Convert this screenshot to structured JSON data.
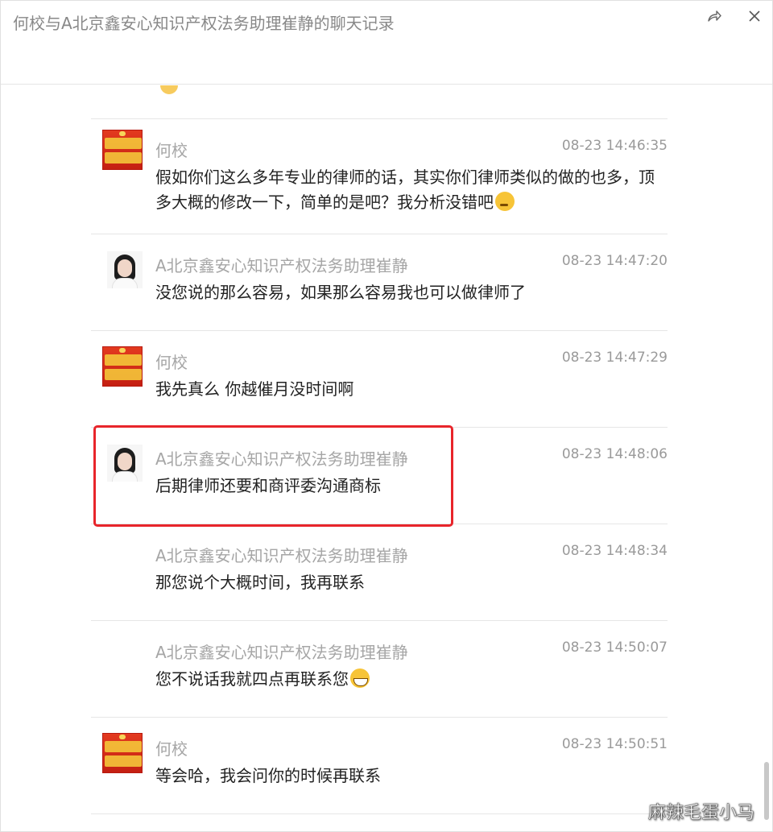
{
  "window": {
    "title": "何校与A北京鑫安心知识产权法务助理崔静的聊天记录",
    "share_icon": "share-arrow-icon",
    "close_icon": "close-icon"
  },
  "messages": [
    {
      "sender": "何校",
      "time": "08-23 14:46:35",
      "text": "假如你们这么多年专业的律师的话，其实你们律师类似的做的也多，顶多大概的修改一下，简单的是吧？我分析没错吧",
      "avatar": "red-banner-avatar",
      "emoji": "thinking-face"
    },
    {
      "sender": "A北京鑫安心知识产权法务助理崔静",
      "time": "08-23 14:47:20",
      "text": "没您说的那么容易，如果那么容易我也可以做律师了",
      "avatar": "woman-photo-avatar"
    },
    {
      "sender": "何校",
      "time": "08-23 14:47:29",
      "text": "我先真么 你越催月没时间啊",
      "avatar": "red-banner-avatar"
    },
    {
      "sender": "A北京鑫安心知识产权法务助理崔静",
      "time": "08-23 14:48:06",
      "text": "后期律师还要和商评委沟通商标",
      "avatar": "woman-photo-avatar",
      "highlighted": true
    },
    {
      "sender": "A北京鑫安心知识产权法务助理崔静",
      "time": "08-23 14:48:34",
      "text": "那您说个大概时间，我再联系",
      "avatar": null
    },
    {
      "sender": "A北京鑫安心知识产权法务助理崔静",
      "time": "08-23 14:50:07",
      "text": "您不说话我就四点再联系您",
      "avatar": null,
      "emoji": "grinning-face"
    },
    {
      "sender": "何校",
      "time": "08-23 14:50:51",
      "text": "等会哈，我会问你的时候再联系",
      "avatar": "red-banner-avatar"
    }
  ],
  "watermark": "麻辣毛蛋小马",
  "colors": {
    "highlight": "#e8252b",
    "sender": "#a6a6a6",
    "time": "#9a9a9a"
  }
}
